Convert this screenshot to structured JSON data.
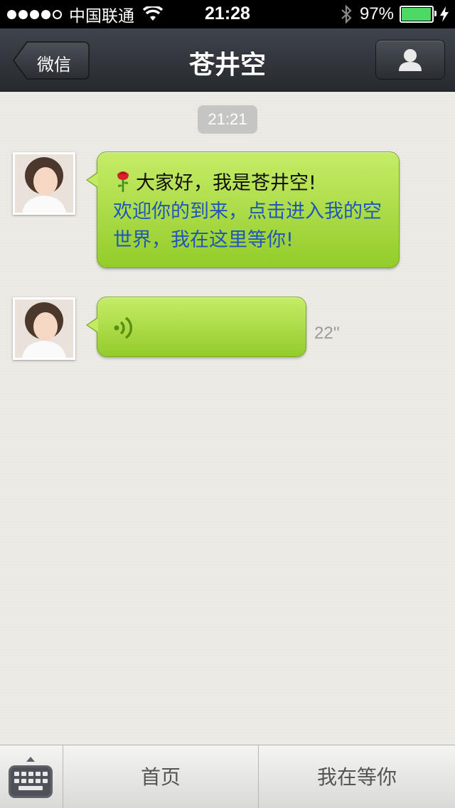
{
  "status_bar": {
    "carrier": "中国联通",
    "time": "21:28",
    "battery_percent": "97%",
    "battery_level": 0.97,
    "icons": [
      "signal-dots-icon",
      "wifi-icon",
      "bluetooth-icon",
      "battery-icon",
      "charging-icon"
    ]
  },
  "nav_bar": {
    "back_label": "微信",
    "title": "苍井空",
    "profile_icon": "person-icon"
  },
  "chat": {
    "timestamp": "21:21",
    "messages": [
      {
        "type": "text",
        "emoji": "rose-icon",
        "greeting": "大家好，我是苍井空!",
        "link_text": "欢迎你的到来，点击进入我的空世界，我在这里等你!"
      },
      {
        "type": "voice",
        "icon": "voice-wave-icon",
        "duration": "22''"
      }
    ]
  },
  "menu_bar": {
    "keyboard_icon": "keyboard-icon",
    "items": [
      {
        "label": "首页"
      },
      {
        "label": "我在等你"
      }
    ]
  },
  "colors": {
    "bubble_green": "#a6d83a",
    "link_blue": "#1f57b8",
    "nav_dark": "#2e3238"
  }
}
